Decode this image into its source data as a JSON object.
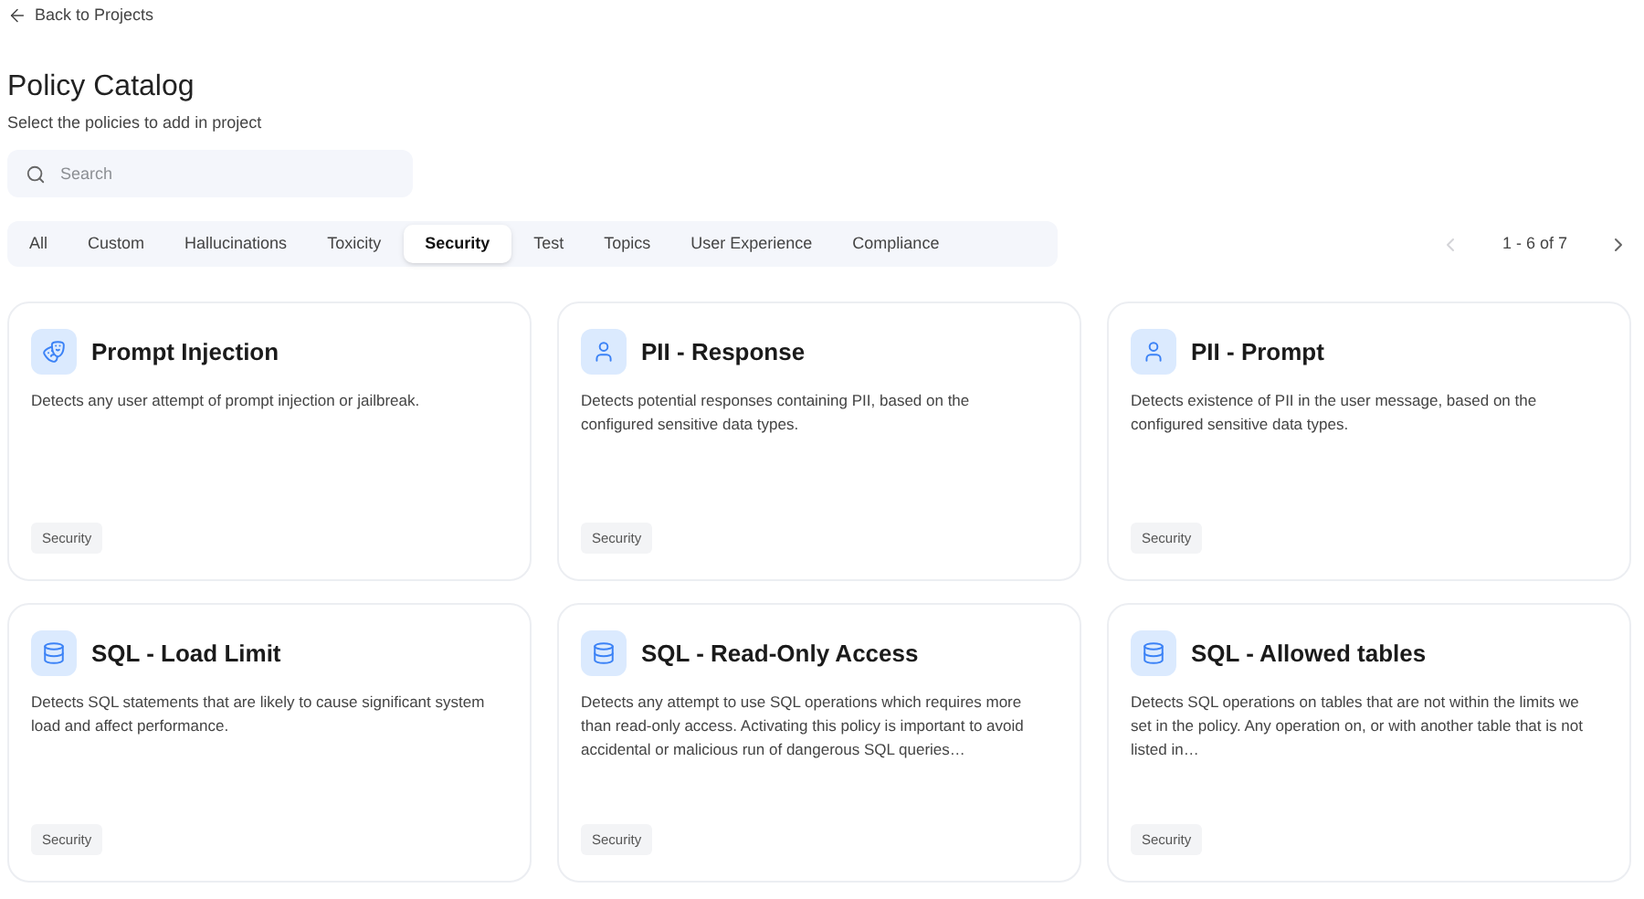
{
  "back_link": "Back to Projects",
  "title": "Policy Catalog",
  "subtitle": "Select the policies to add in project",
  "search": {
    "placeholder": "Search"
  },
  "tabs": [
    {
      "label": "All",
      "selected": false
    },
    {
      "label": "Custom",
      "selected": false
    },
    {
      "label": "Hallucinations",
      "selected": false
    },
    {
      "label": "Toxicity",
      "selected": false
    },
    {
      "label": "Security",
      "selected": true
    },
    {
      "label": "Test",
      "selected": false
    },
    {
      "label": "Topics",
      "selected": false
    },
    {
      "label": "User Experience",
      "selected": false
    },
    {
      "label": "Compliance",
      "selected": false
    }
  ],
  "pagination": {
    "range": "1 - 6 of 7",
    "prev_disabled": true,
    "next_disabled": false
  },
  "policies": [
    {
      "kind": "mask",
      "title": "Prompt Injection",
      "description": "Detects any user attempt of prompt injection or jailbreak.",
      "tag": "Security"
    },
    {
      "kind": "person",
      "title": "PII - Response",
      "description": "Detects potential responses containing PII, based on the configured sensitive data types.",
      "tag": "Security"
    },
    {
      "kind": "person",
      "title": "PII - Prompt",
      "description": "Detects existence of PII in the user message, based on the configured sensitive data types.",
      "tag": "Security"
    },
    {
      "kind": "database",
      "title": "SQL - Load Limit",
      "description": "Detects SQL statements that are likely to cause significant system load and affect performance.",
      "tag": "Security"
    },
    {
      "kind": "database",
      "title": "SQL - Read-Only Access",
      "description": "Detects any attempt to use SQL operations which requires more than read-only access. Activating this policy is important to avoid accidental or malicious run of dangerous SQL queries…",
      "tag": "Security"
    },
    {
      "kind": "database",
      "title": "SQL - Allowed tables",
      "description": "Detects SQL operations on tables that are not within the limits we set in the policy. Any operation on, or with another table that is not listed in…",
      "tag": "Security"
    }
  ]
}
